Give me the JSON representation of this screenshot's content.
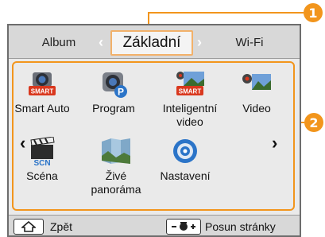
{
  "callouts": {
    "one": "1",
    "two": "2"
  },
  "tabs": {
    "left": "Album",
    "center": "Základní",
    "right": "Wi-Fi"
  },
  "icons": {
    "smart_badge": "SMART",
    "scn_badge": "SCN",
    "program_badge": "P"
  },
  "modes": [
    {
      "label": "Smart Auto",
      "icon": "camera-smart-icon"
    },
    {
      "label": "Program",
      "icon": "camera-program-icon"
    },
    {
      "label": "Inteligentní video",
      "icon": "smart-video-icon"
    },
    {
      "label": "Video",
      "icon": "video-icon"
    },
    {
      "label": "Scéna",
      "icon": "clapper-scene-icon"
    },
    {
      "label": "Živé panoráma",
      "icon": "panorama-icon"
    },
    {
      "label": "Nastavení",
      "icon": "gear-settings-icon"
    }
  ],
  "footer": {
    "back_label": "Zpět",
    "page_label": "Posun stránky"
  },
  "colors": {
    "accent": "#f2951c",
    "badge_red": "#d9381e",
    "program_blue": "#2b74c8"
  }
}
